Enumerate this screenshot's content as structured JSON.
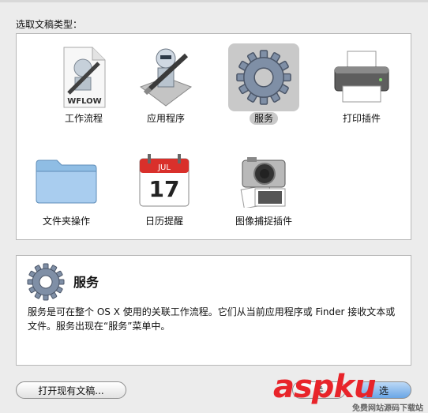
{
  "dialog": {
    "section_label": "选取文稿类型：",
    "types": [
      {
        "label": "工作流程",
        "icon": "workflow-document-icon",
        "icon_text": "WFLOW",
        "selected": false
      },
      {
        "label": "应用程序",
        "icon": "automator-robot-icon",
        "selected": false
      },
      {
        "label": "服务",
        "icon": "gear-icon",
        "selected": true
      },
      {
        "label": "打印插件",
        "icon": "printer-icon",
        "selected": false
      },
      {
        "label": "文件夹操作",
        "icon": "folder-icon",
        "selected": false
      },
      {
        "label": "日历提醒",
        "icon": "calendar-icon",
        "icon_month": "JUL",
        "icon_day": "17",
        "selected": false
      },
      {
        "label": "图像捕捉插件",
        "icon": "camera-icon",
        "selected": false
      }
    ],
    "description": {
      "icon": "gear-icon",
      "title": "服务",
      "text": "服务是可在整个 OS X 使用的关联工作流程。它们从当前应用程序或 Finder 接收文本或文件。服务出现在“服务”菜单中。"
    },
    "buttons": {
      "open_existing": "打开现有文稿...",
      "close": "关",
      "choose": "选"
    }
  },
  "watermark": {
    "main": "aspku",
    "sub": "免费网站源码下载站"
  },
  "colors": {
    "selection": "#c9c9c9",
    "watermark": "#e8242a",
    "default_button": "#6aa6e6"
  }
}
